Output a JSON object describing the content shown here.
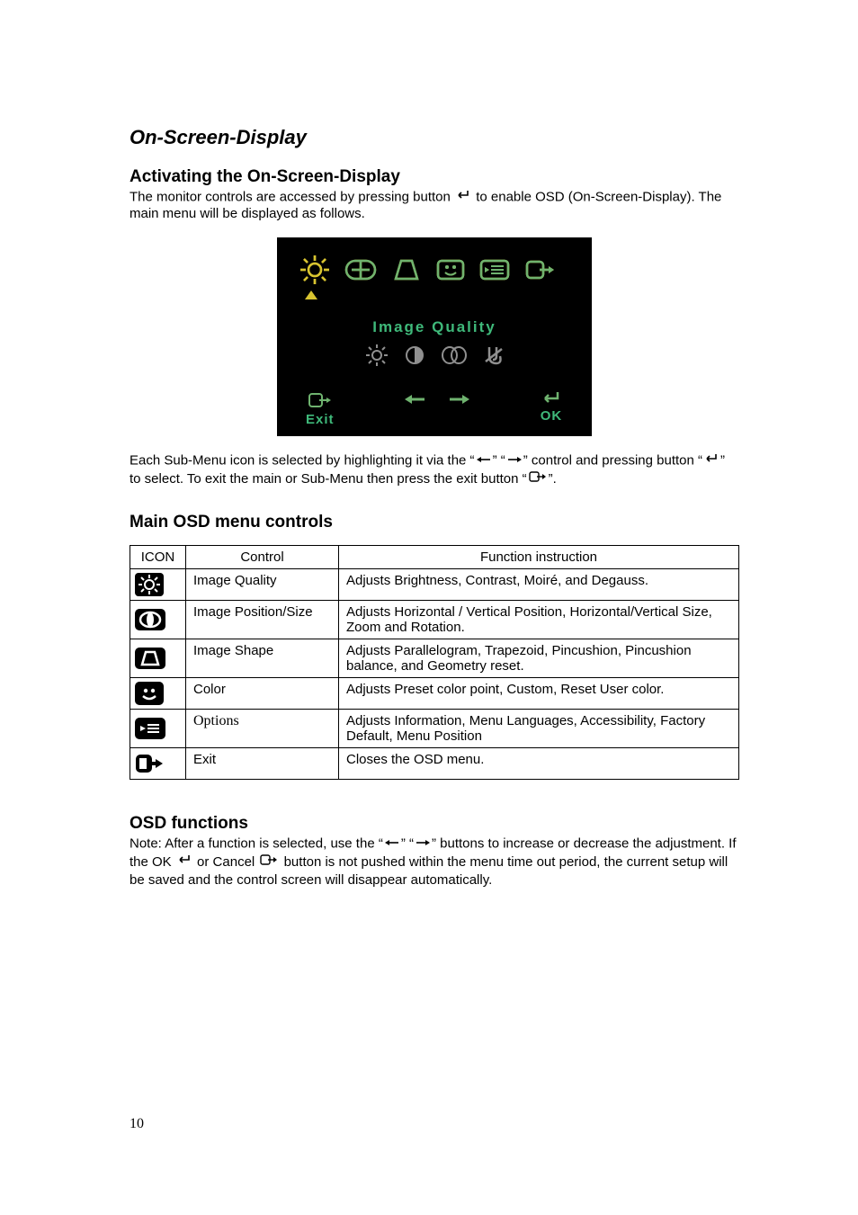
{
  "section_title": "On-Screen-Display",
  "activating": {
    "heading": "Activating the On-Screen-Display",
    "para1_a": "The monitor controls are accessed by pressing button",
    "para1_b": "to enable OSD (On-Screen-Display). The main menu will be displayed as follows."
  },
  "osd_panel": {
    "title": "Image Quality",
    "exit": "Exit",
    "ok": "OK"
  },
  "submenu_desc": {
    "a": "Each Sub-Menu icon is selected by highlighting it via the “",
    "b": "” “",
    "c": "” control and pressing button “",
    "d": "” to select. To exit the main or Sub-Menu then press the exit button “",
    "e": "”."
  },
  "main_controls": {
    "heading": "Main OSD menu controls",
    "headers": {
      "icon": "ICON",
      "control": "Control",
      "function": "Function instruction"
    },
    "rows": [
      {
        "control": "Image Quality",
        "function": "Adjusts Brightness, Contrast, Moiré, and Degauss."
      },
      {
        "control": "Image Position/Size",
        "function": "Adjusts Horizontal / Vertical Position, Horizontal/Vertical Size, Zoom and Rotation."
      },
      {
        "control": "Image Shape",
        "function": "Adjusts Parallelogram, Trapezoid, Pincushion, Pincushion balance, and Geometry reset."
      },
      {
        "control": "Color",
        "function": "Adjusts Preset color point, Custom, Reset User color."
      },
      {
        "control": "Options",
        "function": "Adjusts Information, Menu Languages, Accessibility, Factory Default, Menu Position"
      },
      {
        "control": "Exit",
        "function": "Closes the OSD menu."
      }
    ]
  },
  "osd_functions": {
    "heading": "OSD functions",
    "note_a": "Note: After a function is selected, use the  “",
    "note_b": "” “",
    "note_c": "” buttons to increase or decrease the adjustment. If the OK",
    "note_d": "or Cancel",
    "note_e": "button is not pushed within the menu time out period, the current setup will be saved and the control screen will disappear automatically."
  },
  "page_number": "10"
}
